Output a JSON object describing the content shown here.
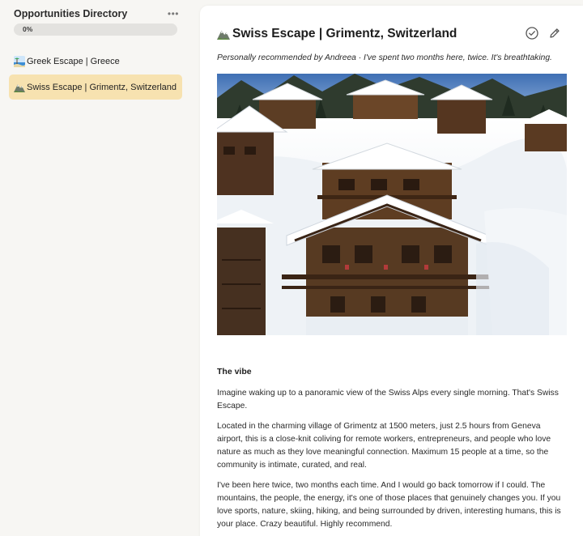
{
  "sidebar": {
    "title": "Opportunities Directory",
    "more_label": "•••",
    "progress": {
      "label": "0%",
      "value": 0
    },
    "items": [
      {
        "label": "Greek Escape | Greece",
        "icon": "beach-emoji-icon",
        "active": false
      },
      {
        "label": "Swiss Escape | Grimentz, Switzerland",
        "icon": "mountain-emoji-icon",
        "active": true
      }
    ]
  },
  "page": {
    "title": "Swiss Escape | Grimentz, Switzerland",
    "title_icon": "mountain-emoji-icon",
    "subtitle": "Personally recommended by Andreea · I've spent two months here, twice. It's breathtaking.",
    "actions": [
      {
        "name": "check-circle-icon"
      },
      {
        "name": "edit-pencil-icon"
      }
    ],
    "image_alt": "Snowy wooden chalets in Grimentz",
    "section_heading": "The vibe",
    "paragraphs": [
      "Imagine waking up to a panoramic view of the Swiss Alps every single morning. That's Swiss Escape.",
      "Located in the charming village of Grimentz at 1500 meters, just 2.5 hours from Geneva airport, this is a close-knit coliving for remote workers, entrepreneurs, and people who love nature as much as they love meaningful connection. Maximum 15 people at a time, so the community is intimate, curated, and real.",
      "I've been here twice, two months each time. And I would go back tomorrow if I could. The mountains, the people, the energy, it's one of those places that genuinely changes you. If you love sports, nature, skiing, hiking, and being surrounded by driven, interesting humans, this is your place. Crazy beautiful. Highly recommend."
    ]
  },
  "colors": {
    "sidebar_bg": "#f7f6f3",
    "active_item": "#f7e2b0",
    "progress_track": "#e3e2df",
    "card_bg": "#ffffff"
  }
}
